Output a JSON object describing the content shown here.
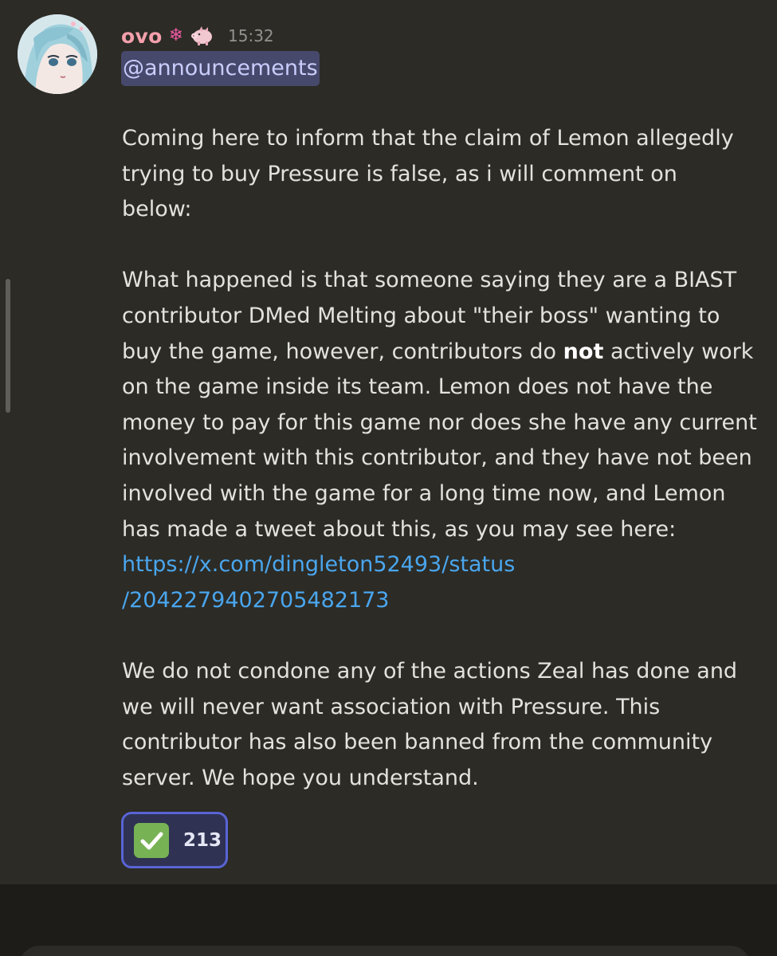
{
  "message": {
    "username": "ovo",
    "username_color": "#f4a0ac",
    "badges": [
      "snowflake-icon",
      "pig-badge-icon"
    ],
    "snowflake_glyph": "❄",
    "timestamp": "15:32",
    "mention": "@announcements",
    "paragraphs": [
      {
        "lines": [
          "Coming here to inform that the claim of Lemon allegedly",
          "trying to buy Pressure is false, as i will comment on",
          "below:"
        ]
      },
      {
        "lines_before_bold": [
          "What happened is that someone saying they are a BIAST",
          "contributor DMed Melting about \"their boss\" wanting to"
        ],
        "bold_line_prefix": "buy the game, however, contributors do ",
        "bold_word": "not",
        "bold_line_suffix": " actively work",
        "lines_after_bold": [
          "on the game inside its team. Lemon does not have the",
          "money to pay for this game nor does she have any current",
          "involvement with this contributor, and they have not been",
          "involved with the game for a long time now, and Lemon",
          "has made a tweet about this, as you may see here:"
        ],
        "link_lines": [
          "https://x.com/dingleton52493/status",
          "/2042279402705482173"
        ]
      },
      {
        "lines": [
          "We do not condone any of the actions Zeal has done and",
          "we will never want association with Pressure. This",
          "contributor has also been banned from the community",
          "server. We hope you understand."
        ]
      }
    ],
    "reaction": {
      "emoji": "white-check-mark-icon",
      "count": "213"
    }
  },
  "colors": {
    "background": "#2c2b26",
    "text": "#e3e2dd",
    "link": "#4aa6ee",
    "mention_bg": "#47496c",
    "mention_text": "#c9cdfb",
    "reaction_border": "#5964d6",
    "reaction_bg": "#2f3253",
    "timestamp": "#93928e"
  }
}
